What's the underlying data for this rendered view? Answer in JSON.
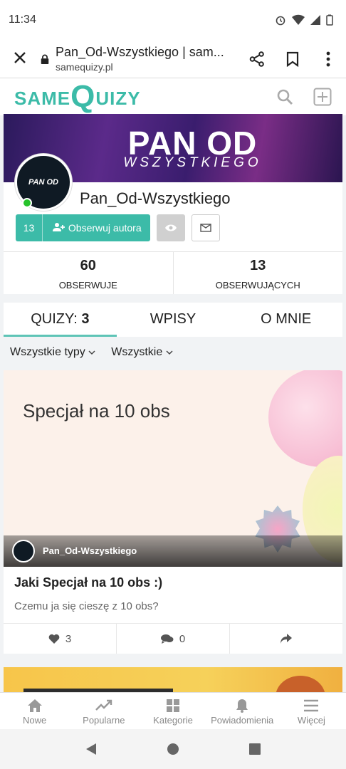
{
  "status_bar": {
    "time": "11:34"
  },
  "browser": {
    "page_title": "Pan_Od-Wszystkiego | sam...",
    "domain": "samequizy.pl"
  },
  "site": {
    "logo_same": "SAME",
    "logo_q": "Q",
    "logo_uizy": "UIZY"
  },
  "profile": {
    "banner_title": "PAN OD",
    "banner_subtitle": "WSZYSTKIEGO",
    "avatar_text": "PAN OD",
    "name": "Pan_Od-Wszystkiego",
    "follow_count": "13",
    "follow_label": "Obserwuj autora",
    "stats": [
      {
        "value": "60",
        "label": "OBSERWUJE"
      },
      {
        "value": "13",
        "label": "OBSERWUJĄCYCH"
      }
    ]
  },
  "tabs": {
    "quizy_label": "QUIZY:",
    "quizy_count": "3",
    "wpisy": "WPISY",
    "o_mnie": "O MNIE"
  },
  "filters": {
    "type": "Wszystkie typy",
    "all": "Wszystkie"
  },
  "quiz_card": {
    "thumb_text": "Specjał na 10 obs",
    "author": "Pan_Od-Wszystkiego",
    "title": "Jaki Specjał na 10 obs :)",
    "description": "Czemu ja się cieszę z 10 obs?",
    "likes": "3",
    "comments": "0"
  },
  "bottom_nav": [
    {
      "label": "Nowe"
    },
    {
      "label": "Popularne"
    },
    {
      "label": "Kategorie"
    },
    {
      "label": "Powiadomienia"
    },
    {
      "label": "Więcej"
    }
  ],
  "colors": {
    "accent": "#3cbba8",
    "online": "#27c22b"
  }
}
